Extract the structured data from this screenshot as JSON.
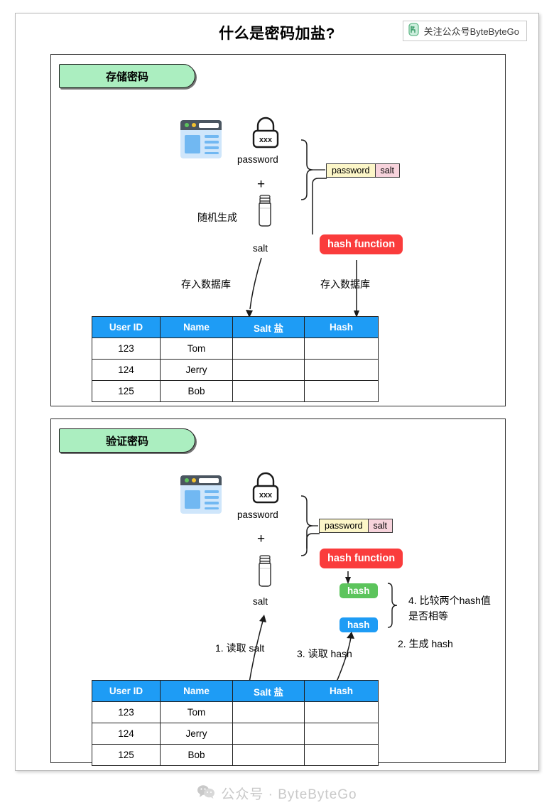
{
  "header": {
    "title": "什么是密码加盐?",
    "badge": {
      "icon": "wechat-official-account-icon",
      "label": "关注公众号ByteByteGo"
    }
  },
  "sections": [
    {
      "id": "store",
      "badge_label": "存储密码",
      "browser_icon": "browser-window-icon",
      "lock_icon": "padlock-icon",
      "lock_glyph": "xxx",
      "password_label": "password",
      "plus": "+",
      "random_label": "随机生成",
      "salt_icon": "salt-shaker-icon",
      "salt_label": "salt",
      "chip_password": "password",
      "chip_salt": "salt",
      "hash_function_label": "hash function",
      "arrow_label_left": "存入数据库",
      "arrow_label_right": "存入数据库",
      "table": {
        "headers": [
          "User ID",
          "Name",
          "Salt 盐",
          "Hash"
        ],
        "rows": [
          [
            "123",
            "Tom",
            "",
            ""
          ],
          [
            "124",
            "Jerry",
            "",
            ""
          ],
          [
            "125",
            "Bob",
            "",
            ""
          ]
        ]
      }
    },
    {
      "id": "verify",
      "badge_label": "验证密码",
      "browser_icon": "browser-window-icon",
      "lock_icon": "padlock-icon",
      "lock_glyph": "xxx",
      "password_label": "password",
      "plus": "+",
      "salt_icon": "salt-shaker-icon",
      "salt_label": "salt",
      "chip_password": "password",
      "chip_salt": "salt",
      "hash_function_label": "hash function",
      "hash_chip_generated": "hash",
      "hash_chip_stored": "hash",
      "step1": "1. 读取 salt",
      "step2": "2. 生成 hash",
      "step3": "3. 读取 hash",
      "step4_line1": "4. 比较两个hash值",
      "step4_line2": "是否相等",
      "table": {
        "headers": [
          "User ID",
          "Name",
          "Salt 盐",
          "Hash"
        ],
        "rows": [
          [
            "123",
            "Tom",
            "",
            ""
          ],
          [
            "124",
            "Jerry",
            "",
            ""
          ],
          [
            "125",
            "Bob",
            "",
            ""
          ]
        ]
      }
    }
  ],
  "footer": {
    "icon": "wechat-bubbles-icon",
    "label": "公众号 · ByteByteGo"
  },
  "colors": {
    "accent_blue": "#1e9cf5",
    "hash_red": "#fa3c3c",
    "hash_green": "#5cc45c",
    "badge_green": "#abeec0",
    "chip_password": "#fcf6c8",
    "chip_salt": "#f7d3dc"
  }
}
